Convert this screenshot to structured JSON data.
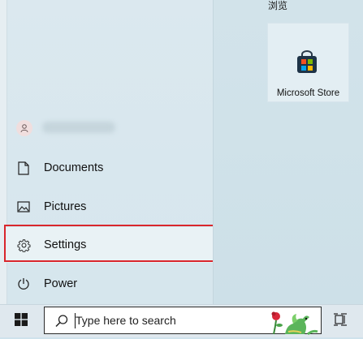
{
  "start_menu": {
    "user": {
      "avatar_icon": "person-icon"
    },
    "items": [
      {
        "label": "Documents",
        "icon": "document-icon"
      },
      {
        "label": "Pictures",
        "icon": "picture-icon"
      },
      {
        "label": "Settings",
        "icon": "gear-icon",
        "highlighted": true
      },
      {
        "label": "Power",
        "icon": "power-icon"
      }
    ]
  },
  "tiles_pane": {
    "section_label": "浏览",
    "tiles": [
      {
        "label": "Microsoft Store",
        "icon": "store-bag-icon"
      }
    ]
  },
  "taskbar": {
    "start_icon": "windows-logo-icon",
    "search": {
      "placeholder": "Type here to search",
      "icon": "search-icon"
    },
    "taskview_icon": "task-view-icon"
  },
  "colors": {
    "highlight_border": "#d9262c",
    "store_red": "#f25022",
    "store_green": "#7fba00",
    "store_blue": "#00a4ef",
    "store_yellow": "#ffb900"
  }
}
